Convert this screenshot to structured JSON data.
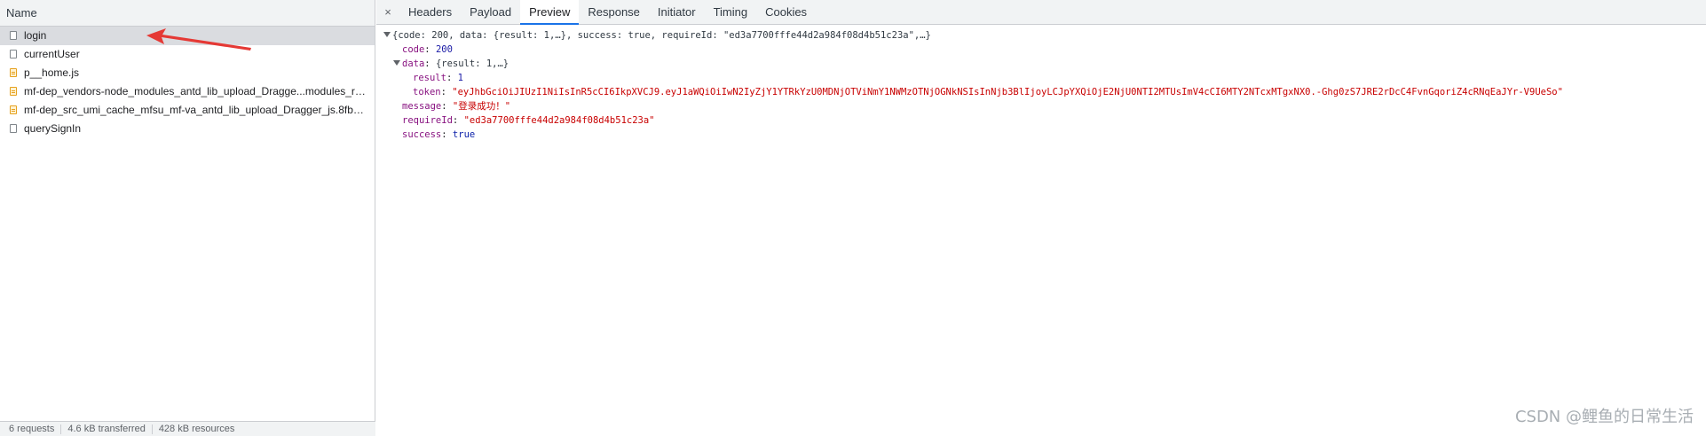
{
  "network": {
    "column_header": "Name",
    "requests": [
      {
        "name": "login",
        "type": "doc",
        "selected": true
      },
      {
        "name": "currentUser",
        "type": "doc",
        "selected": false
      },
      {
        "name": "p__home.js",
        "type": "js",
        "selected": false
      },
      {
        "name": "mf-dep_vendors-node_modules_antd_lib_upload_Dragge...modules_rc-...",
        "type": "js",
        "selected": false
      },
      {
        "name": "mf-dep_src_umi_cache_mfsu_mf-va_antd_lib_upload_Dragger_js.8fb9708...",
        "type": "js",
        "selected": false
      },
      {
        "name": "querySignIn",
        "type": "doc",
        "selected": false
      }
    ],
    "status": {
      "requests": "6 requests",
      "transferred": "4.6 kB transferred",
      "resources": "428 kB resources"
    }
  },
  "details": {
    "close_symbol": "×",
    "tabs": [
      "Headers",
      "Payload",
      "Preview",
      "Response",
      "Initiator",
      "Timing",
      "Cookies"
    ],
    "active_tab": "Preview"
  },
  "preview": {
    "summary": "{code: 200, data: {result: 1,…}, success: true, requireId: \"ed3a7700fffe44d2a984f08d4b51c23a\",…}",
    "code_key": "code",
    "code_val": "200",
    "data_key": "data",
    "data_summary": "{result: 1,…}",
    "result_key": "result",
    "result_val": "1",
    "token_key": "token",
    "token_val": "\"eyJhbGciOiJIUzI1NiIsInR5cCI6IkpXVCJ9.eyJ1aWQiOiIwN2IyZjY1YTRkYzU0MDNjOTViNmY1NWMzOTNjOGNkNSIsInNjb3BlIjoyLCJpYXQiOjE2NjU0NTI2MTUsImV4cCI6MTY2NTcxMTgxNX0.-Ghg0zS7JRE2rDcC4FvnGqoriZ4cRNqEaJYr-V9UeSo\"",
    "message_key": "message",
    "message_val": "\"登录成功！\"",
    "requireId_key": "requireId",
    "requireId_val": "\"ed3a7700fffe44d2a984f08d4b51c23a\"",
    "success_key": "success",
    "success_val": "true"
  },
  "watermark": "CSDN @鲤鱼的日常生活",
  "colors": {
    "accent": "#1a73e8",
    "annotation_arrow": "#e53935",
    "json_key": "#881280",
    "json_string": "#c80000",
    "json_number": "#1a1aa6"
  }
}
